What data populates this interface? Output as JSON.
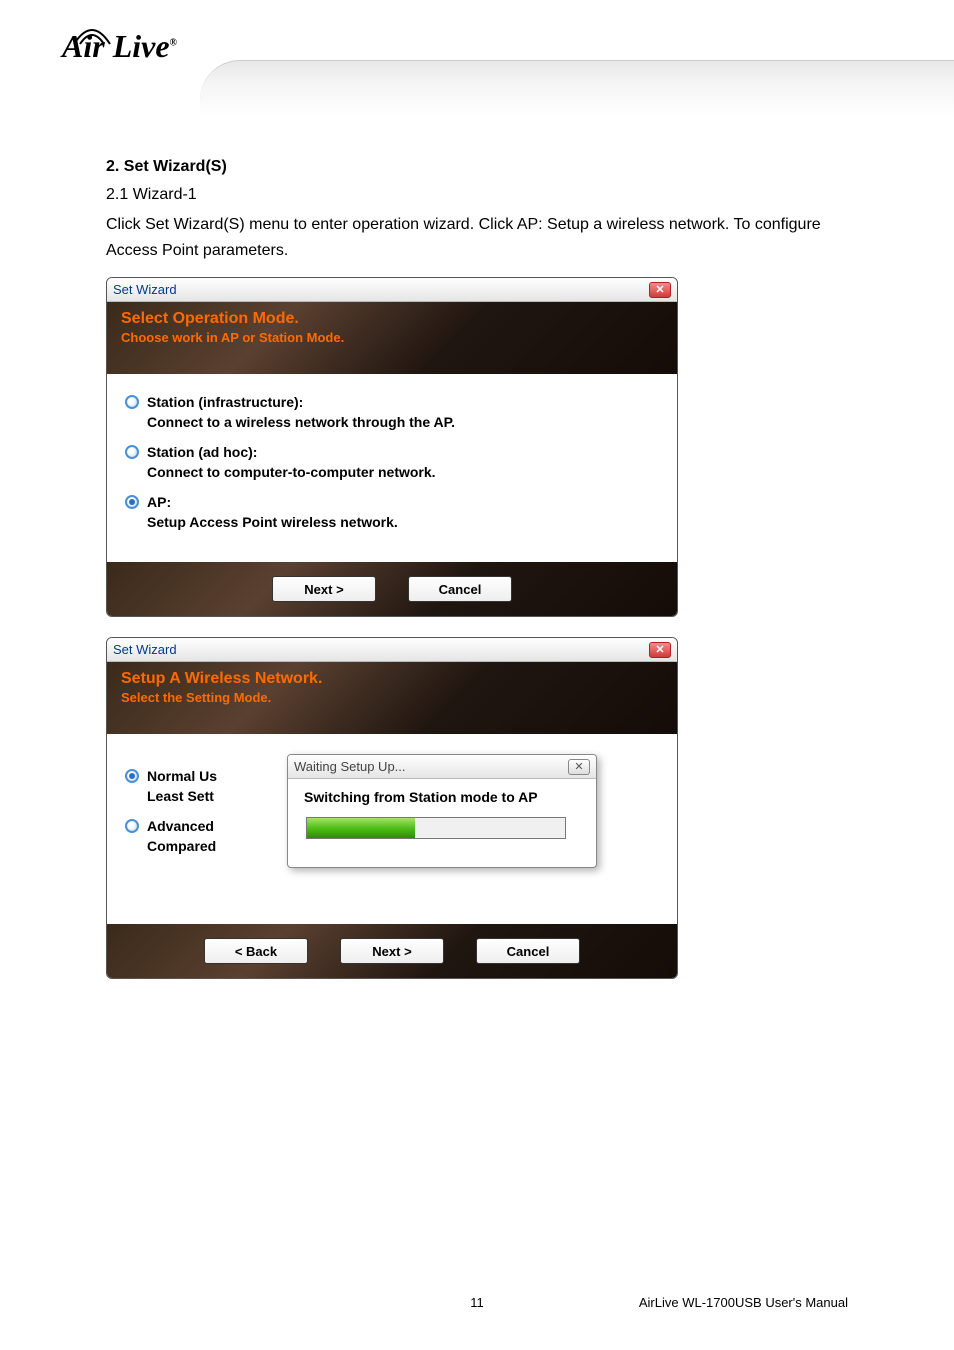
{
  "logo": {
    "brand": "Air Live"
  },
  "article": {
    "heading": "2. Set Wizard(S)",
    "sub": "2.1 Wizard-1",
    "body": "Click Set Wizard(S) menu to enter operation wizard. Click AP: Setup a wireless network. To configure Access Point parameters."
  },
  "dialog1": {
    "title": "Set Wizard",
    "header_title": "Select Operation Mode.",
    "header_sub": "Choose work in AP or Station Mode.",
    "options": [
      {
        "label": "Station (infrastructure):",
        "desc": "Connect to a wireless network through the AP.",
        "selected": false
      },
      {
        "label": "Station (ad hoc):",
        "desc": "Connect to computer-to-computer network.",
        "selected": false
      },
      {
        "label": "AP:",
        "desc": "Setup Access Point wireless network.",
        "selected": true
      }
    ],
    "next": "Next >",
    "cancel": "Cancel"
  },
  "dialog2": {
    "title": "Set Wizard",
    "header_title": "Setup A Wireless Network.",
    "header_sub": "Select the Setting Mode.",
    "opt_normal": "Normal Us",
    "opt_normal_desc": "Least Sett",
    "opt_adv": "Advanced",
    "opt_adv_desc": "Compared",
    "back": "< Back",
    "next": "Next >",
    "cancel": "Cancel"
  },
  "progress": {
    "title": "Waiting Setup Up...",
    "msg": "Switching from Station mode to AP",
    "percent": 42
  },
  "footer": {
    "page": "11",
    "manual": "AirLive WL-1700USB User's Manual"
  }
}
